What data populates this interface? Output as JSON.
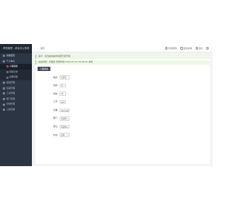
{
  "sidebar": {
    "brand": "考勤管理 - 综合办公系统",
    "items": [
      {
        "label": "系统首页",
        "type": "group"
      },
      {
        "label": "个人中心",
        "type": "group"
      },
      {
        "label": "人事档案",
        "type": "active"
      },
      {
        "label": "考勤记录",
        "type": "sub"
      },
      {
        "label": "请假管理",
        "type": "sub"
      },
      {
        "label": "加班管理",
        "type": "group"
      },
      {
        "label": "出差管理",
        "type": "group"
      },
      {
        "label": "工资管理",
        "type": "group"
      },
      {
        "label": "部门管理",
        "type": "group"
      },
      {
        "label": "系统管理",
        "type": "group"
      },
      {
        "label": "公告管理",
        "type": "group"
      }
    ]
  },
  "topbar": {
    "breadcrumb": "首页",
    "actions": [
      "修改密码",
      "退出系统",
      "消息",
      "设置"
    ]
  },
  "notices": [
    "提示：您当前的操作权限已经开通",
    "最后登录：管理员 登录时间 2023-07-13 15:46:21 本机"
  ],
  "section_tag": "人事档案",
  "form": [
    {
      "label": "姓名",
      "value": "张某某"
    },
    {
      "label": "性别",
      "value": "男"
    },
    {
      "label": "年龄",
      "value": "28"
    },
    {
      "label": "工号",
      "value": "001"
    },
    {
      "label": "日期",
      "value": "2023-07",
      "select": true
    },
    {
      "label": "部门",
      "value": "请选择",
      "select": true
    },
    {
      "label": "职位",
      "value": "请选择",
      "select": true
    },
    {
      "label": "状态",
      "value": "在职",
      "select": true
    }
  ]
}
